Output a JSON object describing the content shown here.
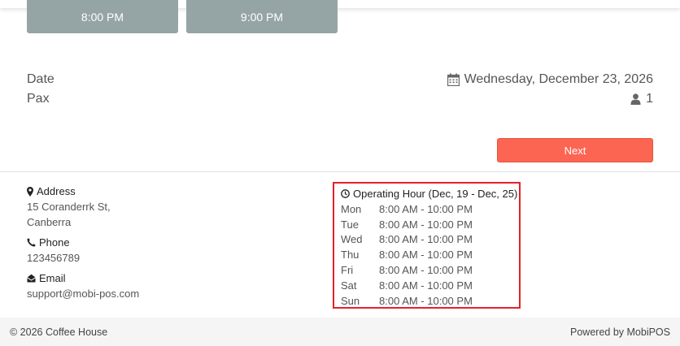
{
  "time_slots": [
    "8:00 PM",
    "9:00 PM"
  ],
  "summary": {
    "date_label": "Date",
    "date_value": "Wednesday, December 23, 2026",
    "pax_label": "Pax",
    "pax_value": "1"
  },
  "next_label": "Next",
  "contact": {
    "address_label": "Address",
    "address_line1": "15 Coranderrk St,",
    "address_line2": "Canberra",
    "phone_label": "Phone",
    "phone_value": "123456789",
    "email_label": "Email",
    "email_value": "support@mobi-pos.com"
  },
  "operating_hours": {
    "title": "Operating Hour (Dec, 19 - Dec, 25)",
    "days": [
      {
        "day": "Mon",
        "hours": "8:00 AM - 10:00 PM"
      },
      {
        "day": "Tue",
        "hours": "8:00 AM - 10:00 PM"
      },
      {
        "day": "Wed",
        "hours": "8:00 AM - 10:00 PM"
      },
      {
        "day": "Thu",
        "hours": "8:00 AM - 10:00 PM"
      },
      {
        "day": "Fri",
        "hours": "8:00 AM - 10:00 PM"
      },
      {
        "day": "Sat",
        "hours": "8:00 AM - 10:00 PM"
      },
      {
        "day": "Sun",
        "hours": "8:00 AM - 10:00 PM"
      }
    ]
  },
  "footer": {
    "copyright": "© 2026 Coffee House",
    "powered_by": "Powered by MobiPOS"
  },
  "colors": {
    "time_slot_bg": "#95a5a6",
    "next_button_bg": "#fd6553",
    "highlight_border": "#e5202a"
  },
  "icons": {
    "date": "calendar-icon",
    "pax": "user-icon",
    "address": "map-marker-icon",
    "phone": "phone-icon",
    "email": "envelope-open-icon",
    "hours": "clock-icon"
  }
}
